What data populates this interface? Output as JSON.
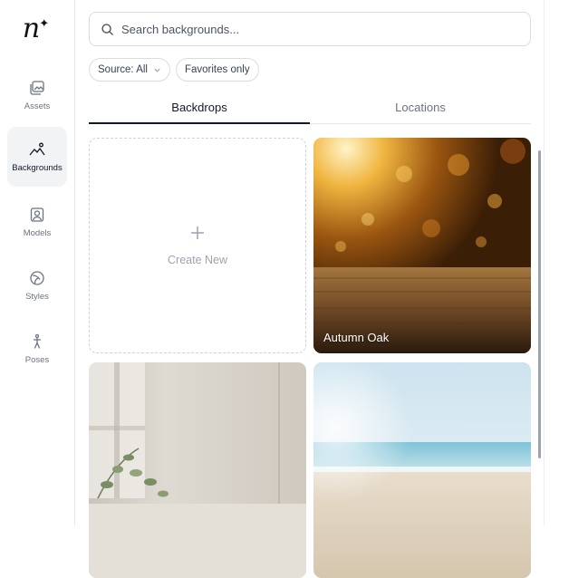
{
  "logo": {
    "text": "n",
    "spark": "✦"
  },
  "sidebar": {
    "items": [
      {
        "label": "Assets",
        "icon": "image-icon",
        "active": false
      },
      {
        "label": "Backgrounds",
        "icon": "landscape-icon",
        "active": true
      },
      {
        "label": "Models",
        "icon": "portrait-icon",
        "active": false
      },
      {
        "label": "Styles",
        "icon": "palette-icon",
        "active": false
      },
      {
        "label": "Poses",
        "icon": "figure-icon",
        "active": false
      }
    ]
  },
  "search": {
    "placeholder": "Search backgrounds...",
    "value": ""
  },
  "filters": {
    "source_label": "Source: All",
    "favorites_label": "Favorites only"
  },
  "tabs": [
    {
      "label": "Backdrops",
      "active": true
    },
    {
      "label": "Locations",
      "active": false
    }
  ],
  "grid": {
    "create_label": "Create New",
    "cards": [
      {
        "label": "Autumn Oak"
      },
      {
        "label": ""
      },
      {
        "label": ""
      }
    ]
  },
  "colors": {
    "accent": "#111827",
    "active_nav_bg": "#f1f3f5",
    "border": "#d9dce1"
  }
}
